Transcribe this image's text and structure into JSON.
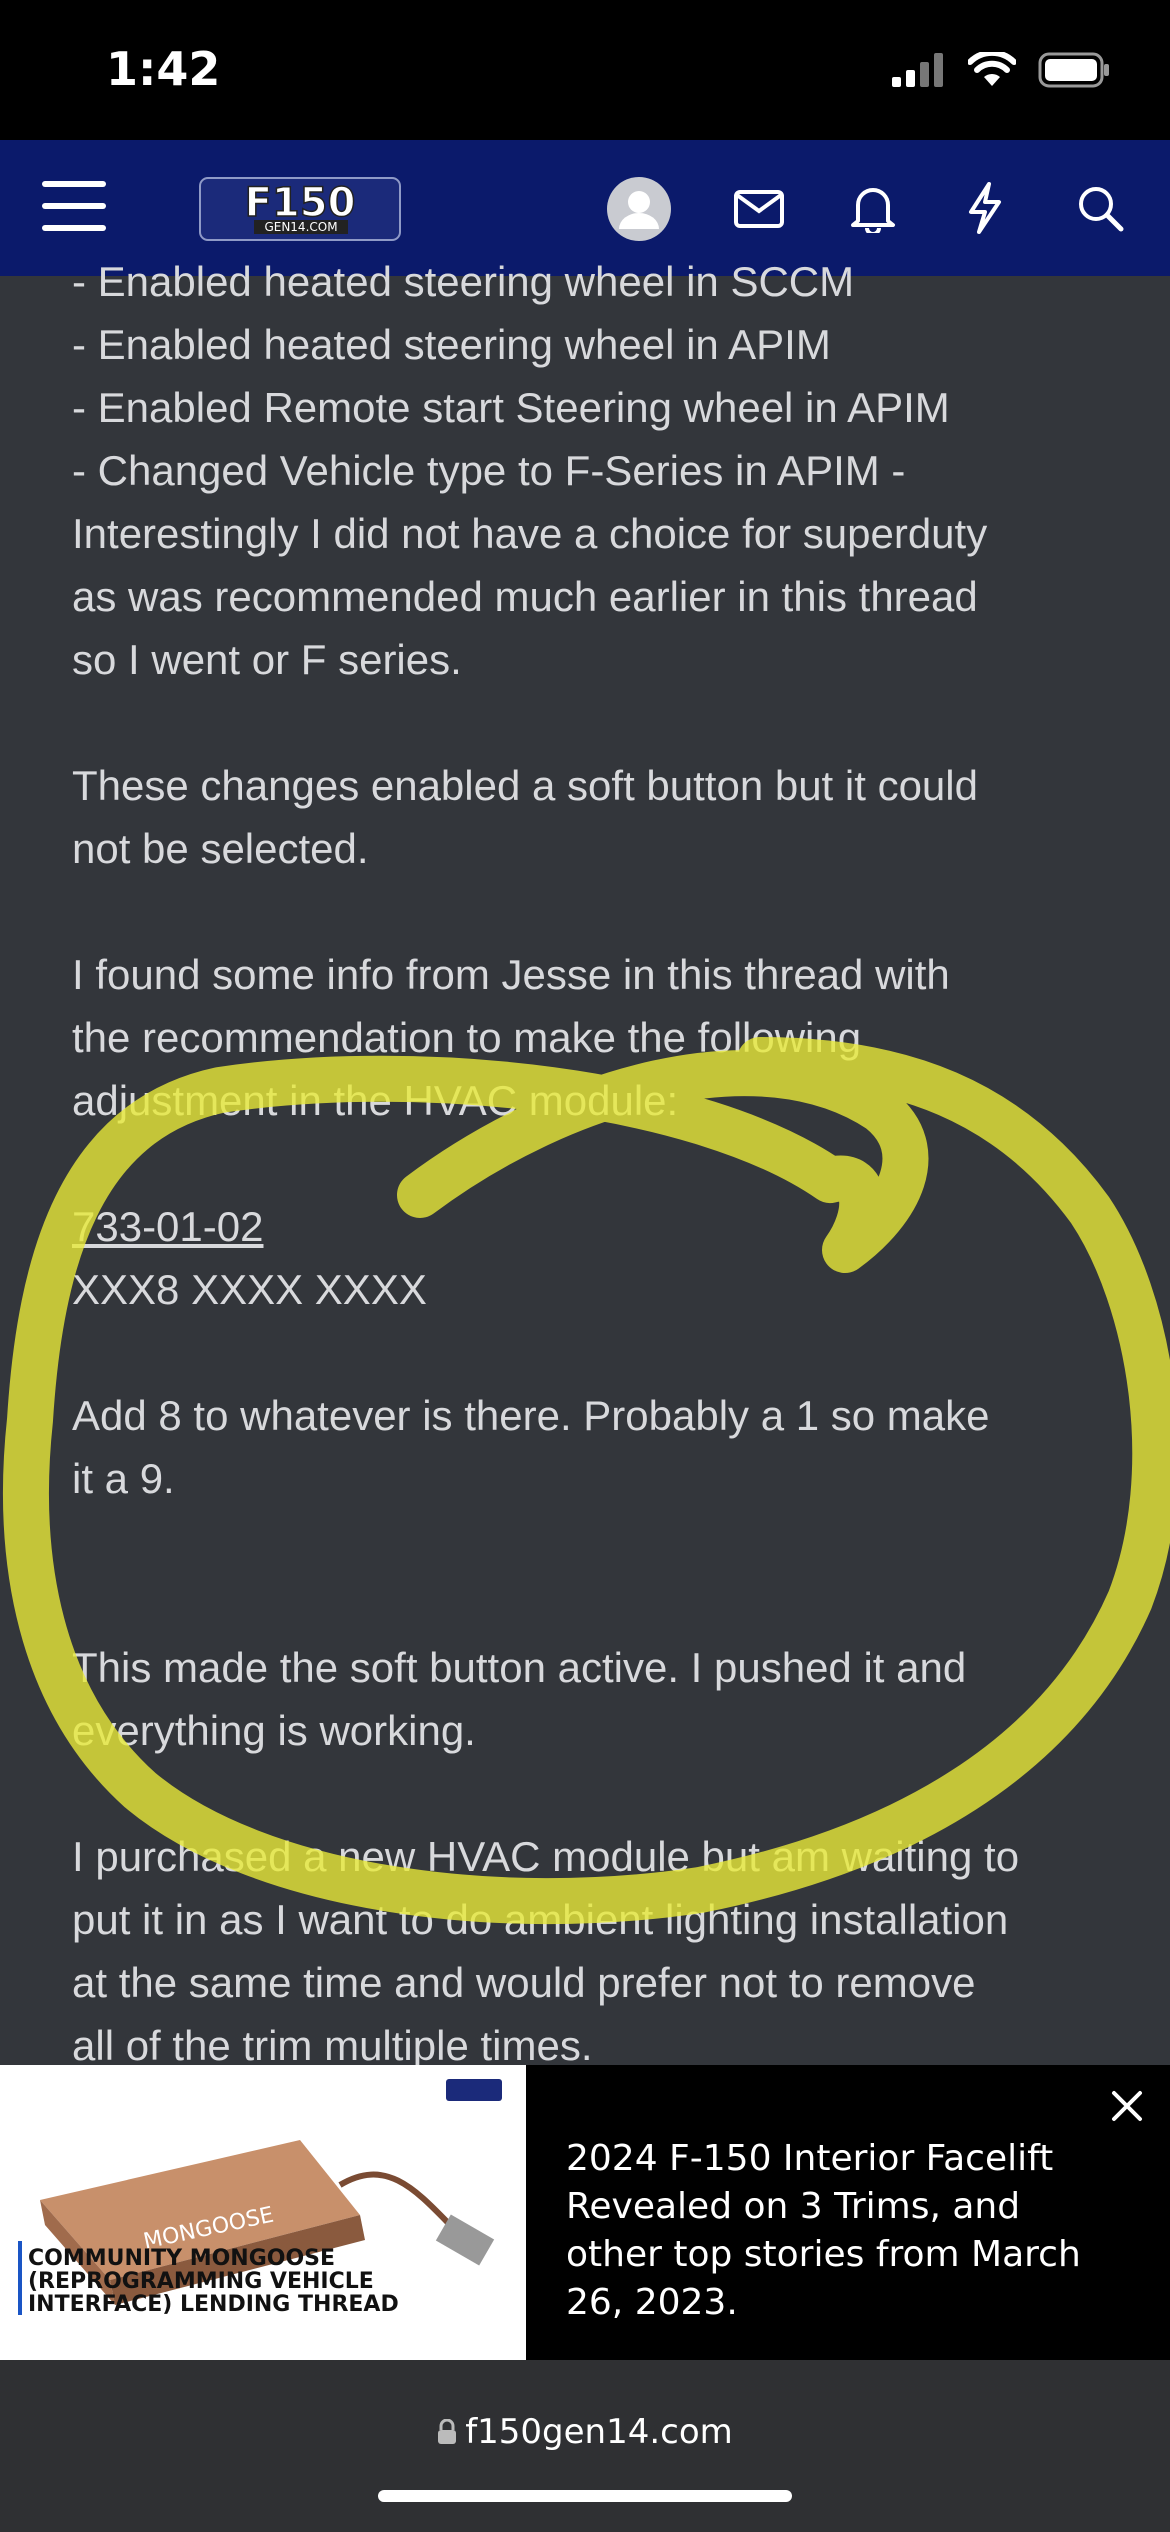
{
  "status": {
    "time": "1:42"
  },
  "nav": {
    "logo_text": "F150",
    "logo_sub": "GEN14.COM"
  },
  "post": {
    "lines": [
      "- Enabled heated steering wheel in SCCM",
      "- Enabled heated steering wheel in APIM",
      "- Enabled Remote start Steering wheel in APIM",
      "- Changed Vehicle type to F-Series in APIM -",
      "Interestingly I did not have a choice for superduty",
      "as was recommended much earlier in this thread",
      "so I went or F series."
    ],
    "para2": [
      "These changes enabled a soft button but it could",
      "not be selected."
    ],
    "para3": [
      "I found some info from Jesse in this thread with",
      "the recommendation to make the following",
      "adjustment in the HVAC module:"
    ],
    "code_link": "733-01-02",
    "code_value": "XXX8 XXXX XXXX",
    "para4": [
      "Add 8 to whatever is there. Probably a 1 so make",
      "it a 9."
    ],
    "para5": [
      "This made the soft button active. I pushed it and",
      "everything is working."
    ],
    "para6": [
      "I purchased a new HVAC module but am waiting to",
      "put it in as I want to do ambient lighting installation",
      "at the same time and would prefer not to remove",
      "all of the trim multiple times."
    ]
  },
  "ad": {
    "image_caption": [
      "COMMUNITY MONGOOSE",
      "(REPROGRAMMING VEHICLE",
      "INTERFACE) LENDING THREAD"
    ],
    "product_label": "MONGOOSE",
    "headline": "2024 F-150 Interior Facelift Revealed on 3 Trims, and other top stories from March 26, 2023."
  },
  "browser": {
    "url": "f150gen14.com"
  },
  "colors": {
    "nav_bg": "#0b1a6b",
    "page_bg": "#33363b",
    "highlight": "#e8ea3a"
  }
}
